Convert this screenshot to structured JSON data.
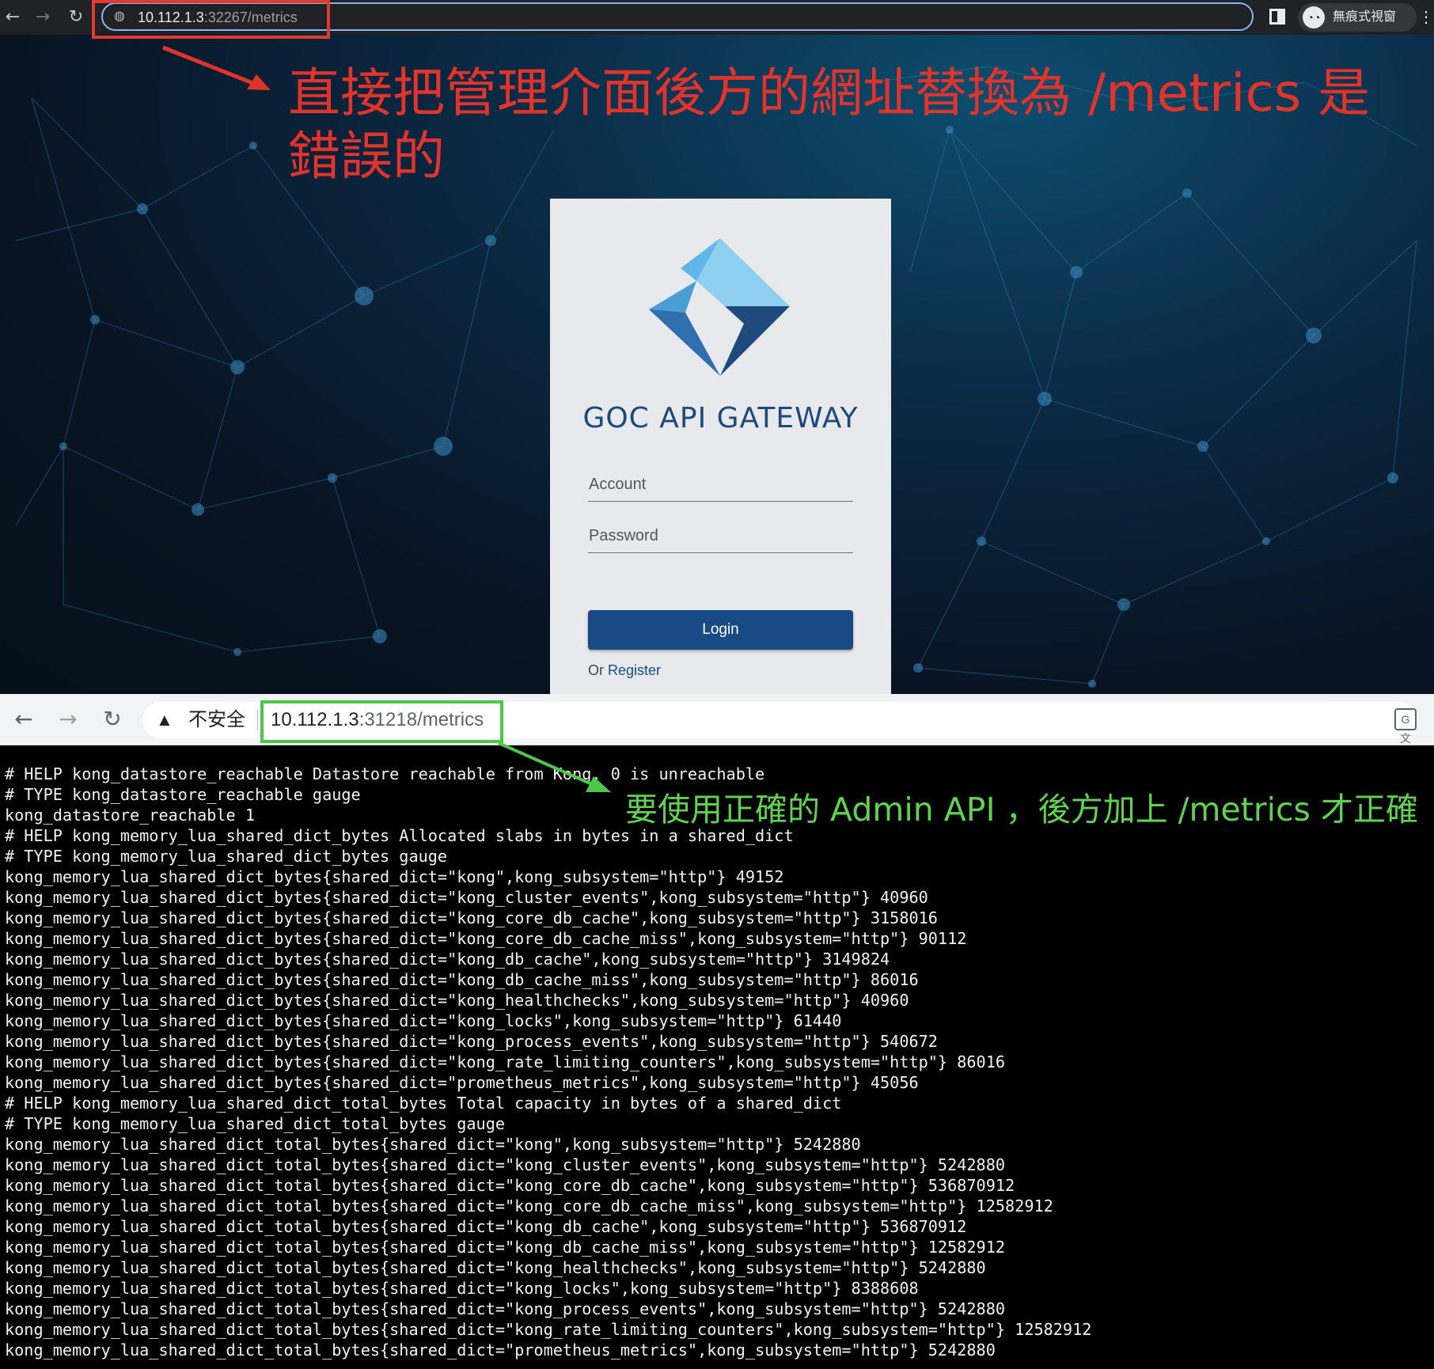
{
  "top_browser": {
    "url_host": "10.112.1.3",
    "url_rest": ":32267/metrics",
    "incognito_label": "無痕式視窗",
    "annotation": "直接把管理介面後方的網址替換為 /metrics 是錯誤的"
  },
  "login": {
    "brand": "GOC API GATEWAY",
    "account_placeholder": "Account",
    "password_placeholder": "Password",
    "login_button": "Login",
    "or_text": "Or",
    "register_link": "Register"
  },
  "bottom_browser": {
    "insecure_label": "不安全",
    "url_host": "10.112.1.3",
    "url_rest": ":31218/metrics",
    "annotation": "要使用正確的 Admin API ，後方加上 /metrics 才正確",
    "metrics_lines": [
      "# HELP kong_datastore_reachable Datastore reachable from Kong, 0 is unreachable",
      "# TYPE kong_datastore_reachable gauge",
      "kong_datastore_reachable 1",
      "# HELP kong_memory_lua_shared_dict_bytes Allocated slabs in bytes in a shared_dict",
      "# TYPE kong_memory_lua_shared_dict_bytes gauge",
      "kong_memory_lua_shared_dict_bytes{shared_dict=\"kong\",kong_subsystem=\"http\"} 49152",
      "kong_memory_lua_shared_dict_bytes{shared_dict=\"kong_cluster_events\",kong_subsystem=\"http\"} 40960",
      "kong_memory_lua_shared_dict_bytes{shared_dict=\"kong_core_db_cache\",kong_subsystem=\"http\"} 3158016",
      "kong_memory_lua_shared_dict_bytes{shared_dict=\"kong_core_db_cache_miss\",kong_subsystem=\"http\"} 90112",
      "kong_memory_lua_shared_dict_bytes{shared_dict=\"kong_db_cache\",kong_subsystem=\"http\"} 3149824",
      "kong_memory_lua_shared_dict_bytes{shared_dict=\"kong_db_cache_miss\",kong_subsystem=\"http\"} 86016",
      "kong_memory_lua_shared_dict_bytes{shared_dict=\"kong_healthchecks\",kong_subsystem=\"http\"} 40960",
      "kong_memory_lua_shared_dict_bytes{shared_dict=\"kong_locks\",kong_subsystem=\"http\"} 61440",
      "kong_memory_lua_shared_dict_bytes{shared_dict=\"kong_process_events\",kong_subsystem=\"http\"} 540672",
      "kong_memory_lua_shared_dict_bytes{shared_dict=\"kong_rate_limiting_counters\",kong_subsystem=\"http\"} 86016",
      "kong_memory_lua_shared_dict_bytes{shared_dict=\"prometheus_metrics\",kong_subsystem=\"http\"} 45056",
      "# HELP kong_memory_lua_shared_dict_total_bytes Total capacity in bytes of a shared_dict",
      "# TYPE kong_memory_lua_shared_dict_total_bytes gauge",
      "kong_memory_lua_shared_dict_total_bytes{shared_dict=\"kong\",kong_subsystem=\"http\"} 5242880",
      "kong_memory_lua_shared_dict_total_bytes{shared_dict=\"kong_cluster_events\",kong_subsystem=\"http\"} 5242880",
      "kong_memory_lua_shared_dict_total_bytes{shared_dict=\"kong_core_db_cache\",kong_subsystem=\"http\"} 536870912",
      "kong_memory_lua_shared_dict_total_bytes{shared_dict=\"kong_core_db_cache_miss\",kong_subsystem=\"http\"} 12582912",
      "kong_memory_lua_shared_dict_total_bytes{shared_dict=\"kong_db_cache\",kong_subsystem=\"http\"} 536870912",
      "kong_memory_lua_shared_dict_total_bytes{shared_dict=\"kong_db_cache_miss\",kong_subsystem=\"http\"} 12582912",
      "kong_memory_lua_shared_dict_total_bytes{shared_dict=\"kong_healthchecks\",kong_subsystem=\"http\"} 5242880",
      "kong_memory_lua_shared_dict_total_bytes{shared_dict=\"kong_locks\",kong_subsystem=\"http\"} 8388608",
      "kong_memory_lua_shared_dict_total_bytes{shared_dict=\"kong_process_events\",kong_subsystem=\"http\"} 5242880",
      "kong_memory_lua_shared_dict_total_bytes{shared_dict=\"kong_rate_limiting_counters\",kong_subsystem=\"http\"} 12582912",
      "kong_memory_lua_shared_dict_total_bytes{shared_dict=\"prometheus_metrics\",kong_subsystem=\"http\"} 5242880"
    ]
  },
  "icons": {
    "back": "back-arrow-icon",
    "forward": "forward-arrow-icon",
    "reload": "reload-icon",
    "site_info": "site-info-icon",
    "side_panel": "side-panel-icon",
    "incognito": "incognito-icon",
    "menu": "kebab-menu-icon",
    "warning": "warning-icon",
    "translate": "translate-icon"
  },
  "colors": {
    "annotation_red": "#e0332b",
    "annotation_green": "#5fd34f",
    "brand_blue": "#1a4a86"
  }
}
